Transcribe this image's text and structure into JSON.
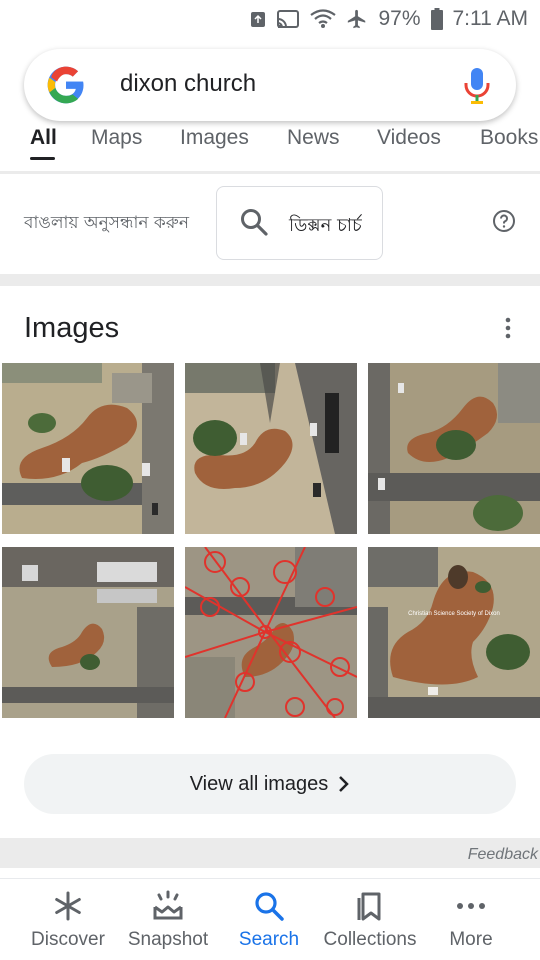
{
  "status_bar": {
    "battery": "97%",
    "time": "7:11 AM"
  },
  "search": {
    "query": "dixon church"
  },
  "tabs": [
    {
      "label": "All"
    },
    {
      "label": "Maps"
    },
    {
      "label": "Images"
    },
    {
      "label": "News"
    },
    {
      "label": "Videos"
    },
    {
      "label": "Books"
    }
  ],
  "bengali": {
    "label": "বাঙলায় অনুসন্ধান করুন",
    "button_text": "ডিক্সন চার্চ"
  },
  "images_section": {
    "title": "Images",
    "overlay_text": "Christian Science Society of Dixon",
    "view_all": "View all images"
  },
  "feedback": "Feedback",
  "bottom_nav": [
    {
      "label": "Discover"
    },
    {
      "label": "Snapshot"
    },
    {
      "label": "Search"
    },
    {
      "label": "Collections"
    },
    {
      "label": "More"
    }
  ],
  "colors": {
    "accent": "#1a73e8",
    "roof": "#a0623c",
    "text": "#202124",
    "muted": "#5f6368"
  }
}
